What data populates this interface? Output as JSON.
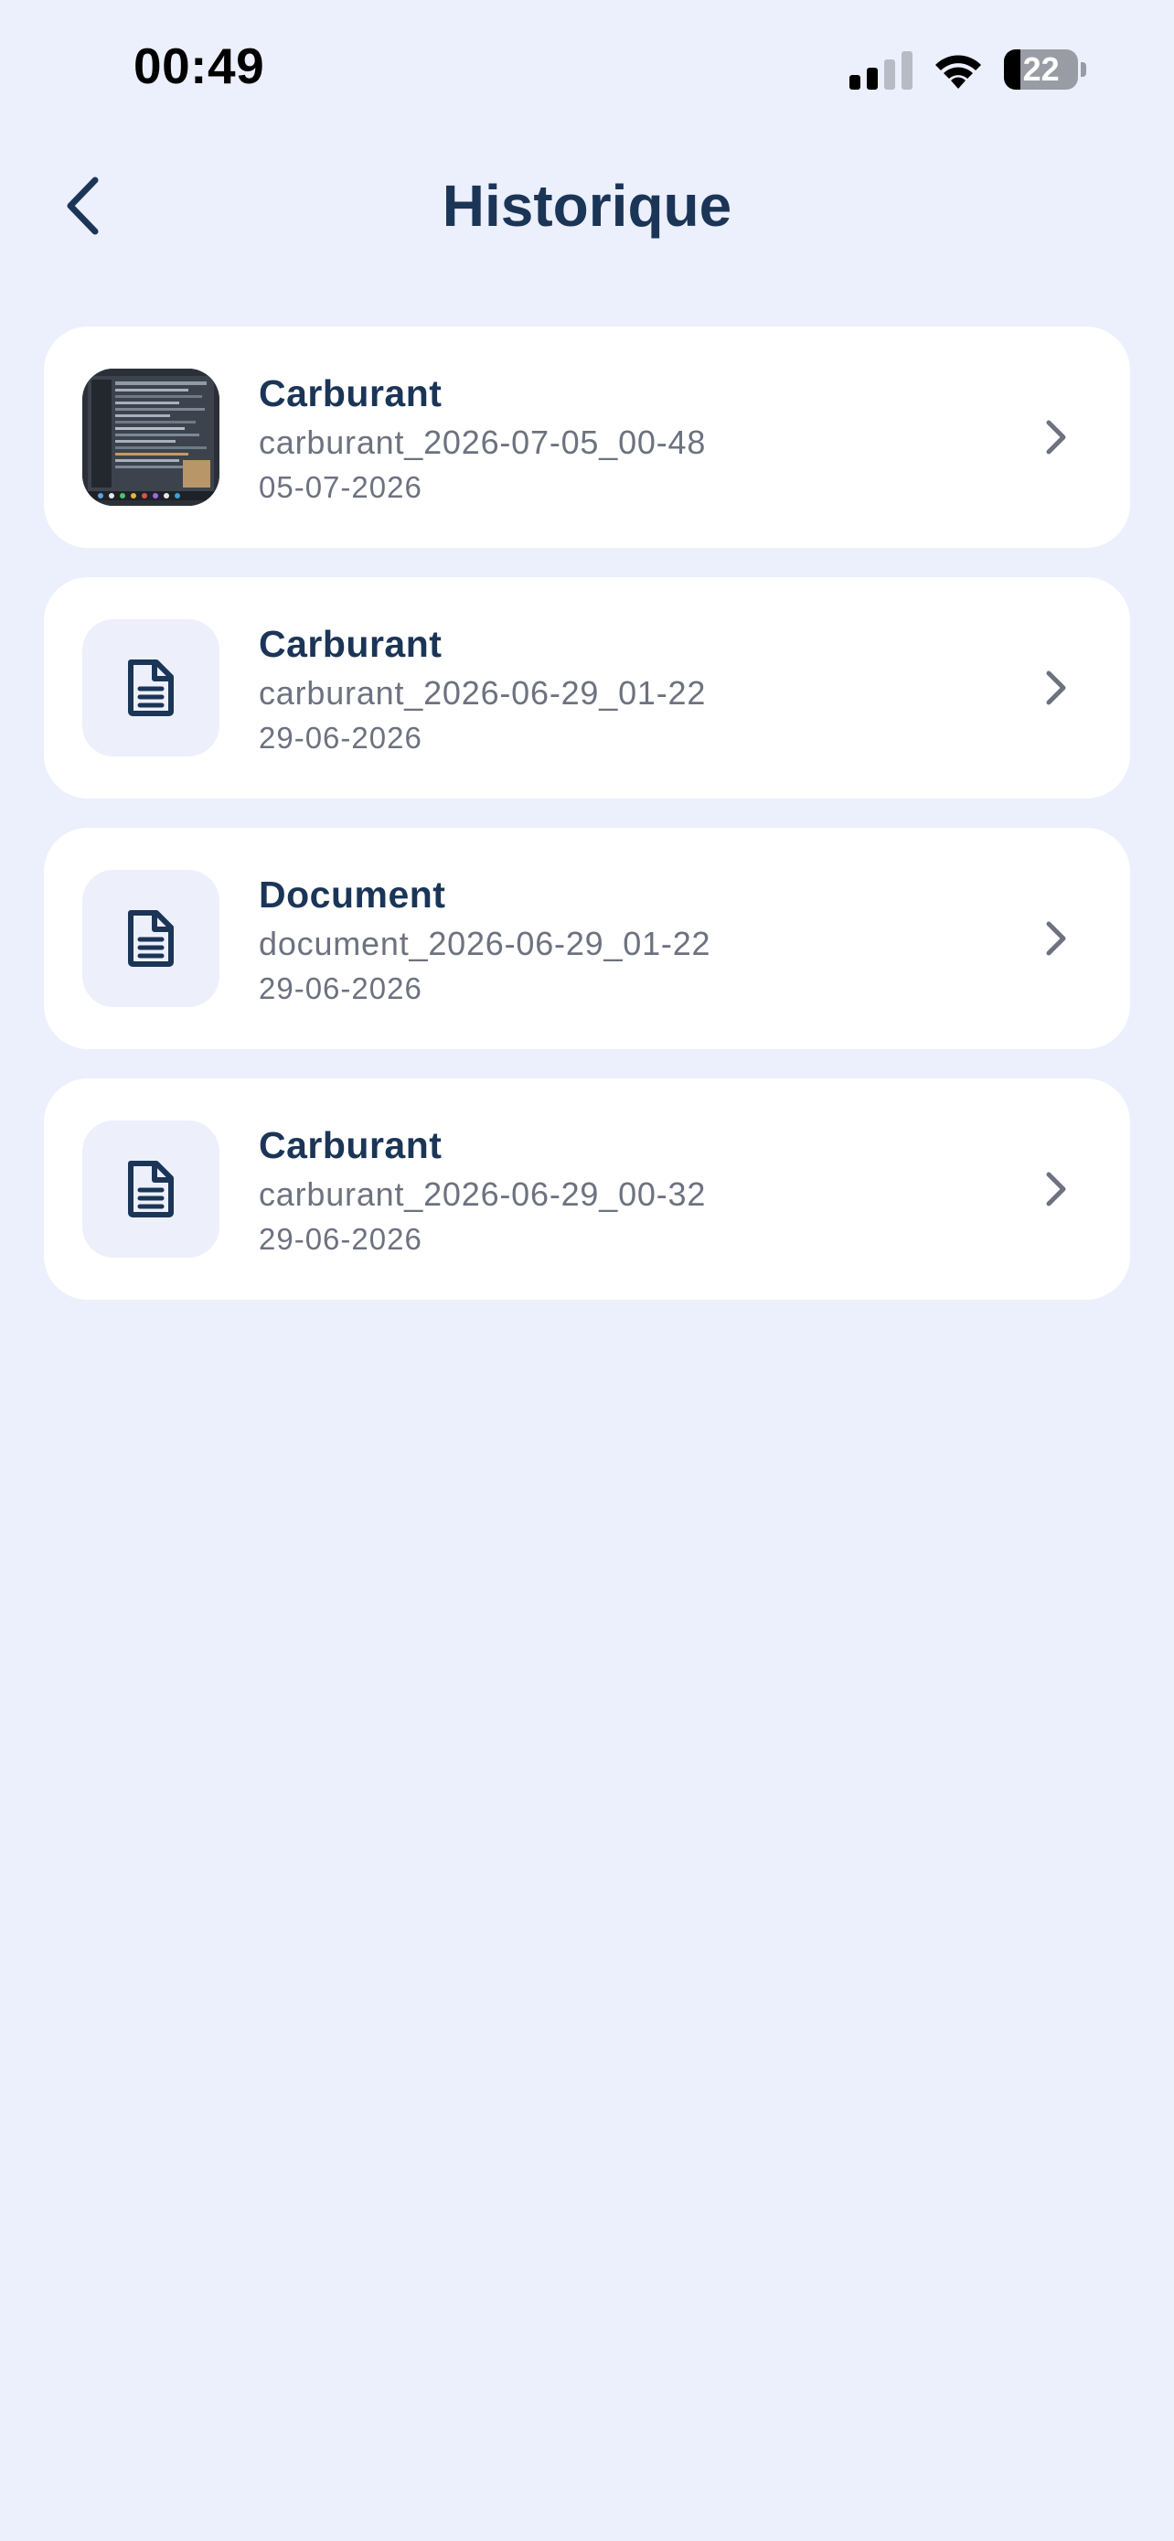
{
  "status_bar": {
    "time": "00:49",
    "battery_level": "22",
    "signal_bars_active": 2,
    "signal_bars_total": 4
  },
  "header": {
    "title": "Historique",
    "back_icon": "chevron-left-icon"
  },
  "colors": {
    "background": "#ECEFFC",
    "card": "#FFFFFF",
    "title_text": "#1B3557",
    "secondary_text": "#6D7280",
    "icon_tile": "#EDF0FB"
  },
  "history": {
    "items": [
      {
        "title": "Carburant",
        "filename": "carburant_2026-07-05_00-48",
        "date": "05-07-2026",
        "thumbnail": "photo-thumbnail"
      },
      {
        "title": "Carburant",
        "filename": "carburant_2026-06-29_01-22",
        "date": "29-06-2026",
        "thumbnail": "document-icon"
      },
      {
        "title": "Document",
        "filename": "document_2026-06-29_01-22",
        "date": "29-06-2026",
        "thumbnail": "document-icon"
      },
      {
        "title": "Carburant",
        "filename": "carburant_2026-06-29_00-32",
        "date": "29-06-2026",
        "thumbnail": "document-icon"
      }
    ]
  }
}
